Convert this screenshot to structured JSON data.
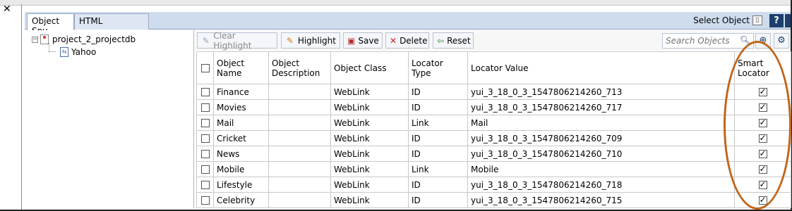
{
  "window": {
    "close_glyph": "✕"
  },
  "tabs": {
    "active": "Object Spy",
    "inactive": "HTML"
  },
  "header": {
    "select_object": "Select Object",
    "help": "?"
  },
  "tree": {
    "project": "project_2_projectdb",
    "page": "Yahoo"
  },
  "toolbar": {
    "clear_highlight": "Clear Highlight",
    "highlight": "Highlight",
    "save": "Save",
    "delete": "Delete",
    "reset": "Reset",
    "search_placeholder": "Search Objects"
  },
  "columns": {
    "name": "Object Name",
    "description": "Object Description",
    "class": "Object Class",
    "locator_type": "Locator Type",
    "locator_value": "Locator Value",
    "smart_locator": "Smart Locator"
  },
  "rows": [
    {
      "name": "Finance",
      "description": "",
      "class": "WebLink",
      "type": "ID",
      "value": "yui_3_18_0_3_1547806214260_713",
      "smart": true
    },
    {
      "name": "Movies",
      "description": "",
      "class": "WebLink",
      "type": "ID",
      "value": "yui_3_18_0_3_1547806214260_717",
      "smart": true
    },
    {
      "name": "Mail",
      "description": "",
      "class": "WebLink",
      "type": "Link",
      "value": "Mail",
      "smart": true
    },
    {
      "name": "Cricket",
      "description": "",
      "class": "WebLink",
      "type": "ID",
      "value": "yui_3_18_0_3_1547806214260_709",
      "smart": true
    },
    {
      "name": "News",
      "description": "",
      "class": "WebLink",
      "type": "ID",
      "value": "yui_3_18_0_3_1547806214260_710",
      "smart": true
    },
    {
      "name": "Mobile",
      "description": "",
      "class": "WebLink",
      "type": "Link",
      "value": "Mobile",
      "smart": true
    },
    {
      "name": "Lifestyle",
      "description": "",
      "class": "WebLink",
      "type": "ID",
      "value": "yui_3_18_0_3_1547806214260_718",
      "smart": true
    },
    {
      "name": "Celebrity",
      "description": "",
      "class": "WebLink",
      "type": "ID",
      "value": "yui_3_18_0_3_1547806214260_715",
      "smart": true
    }
  ],
  "colors": {
    "tab_strip": "#cfdcee",
    "accent": "#1c3f6e",
    "annotation": "#c0651a"
  }
}
